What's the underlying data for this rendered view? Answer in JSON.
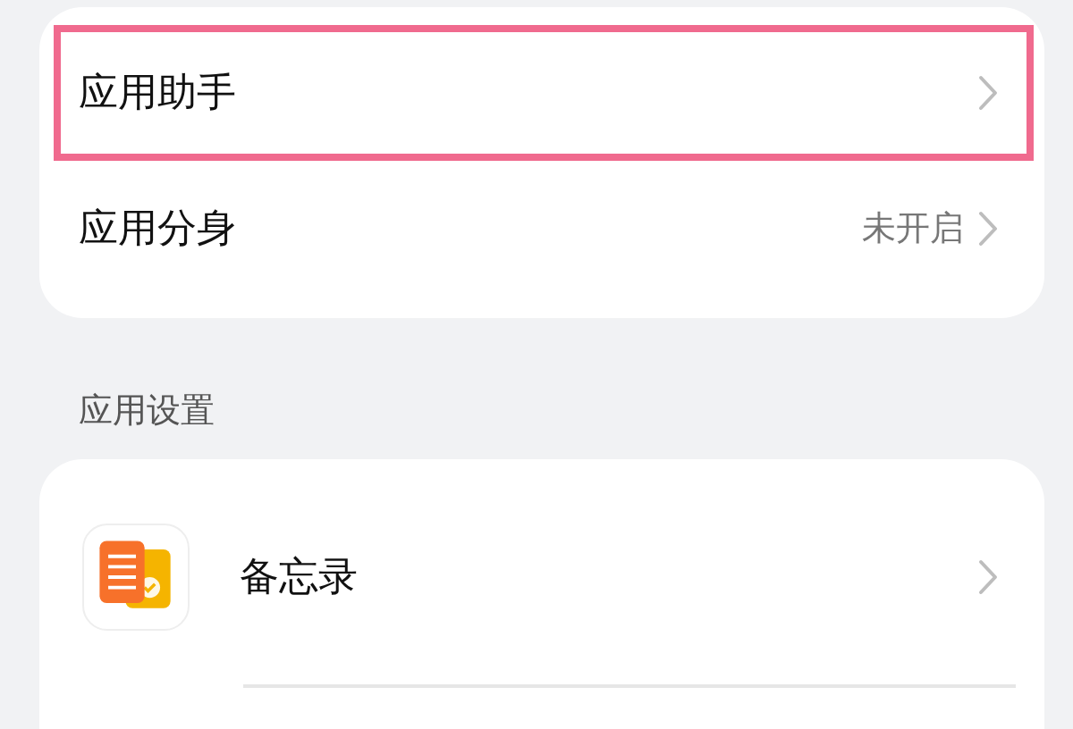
{
  "groups": [
    {
      "items": [
        {
          "kind": "plain",
          "title": "应用助手",
          "highlighted": true
        },
        {
          "kind": "plain",
          "title": "应用分身",
          "value": "未开启",
          "highlighted": false
        }
      ]
    },
    {
      "header": "应用设置",
      "items": [
        {
          "kind": "app",
          "title": "备忘录",
          "highlighted": false
        }
      ]
    }
  ]
}
